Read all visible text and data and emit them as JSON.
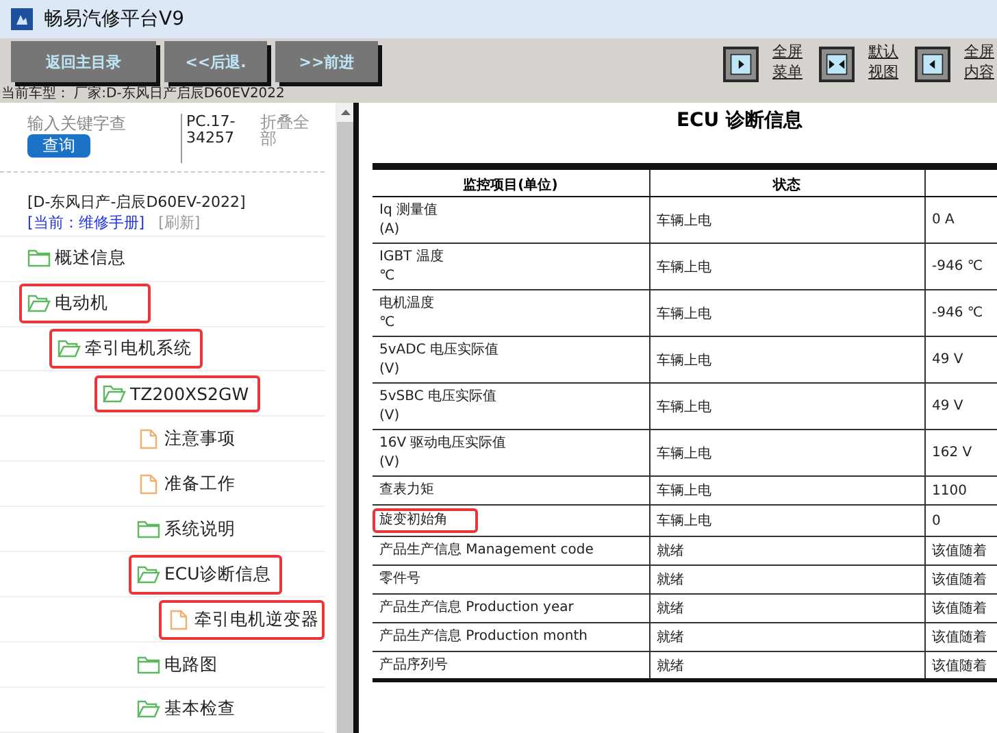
{
  "window": {
    "title": "畅易汽修平台V9"
  },
  "toolbar": {
    "buttons": [
      "返回主目录",
      "<<后退.",
      ">>前进"
    ],
    "view_buttons": [
      {
        "kind": "right",
        "lines": [
          "全屏",
          "菜单"
        ]
      },
      {
        "kind": "both",
        "lines": [
          "默认",
          "视图"
        ]
      },
      {
        "kind": "left",
        "lines": [
          "全屏",
          "内容"
        ]
      }
    ]
  },
  "vehicle_line": "当前车型： 厂家:D-东风日产启辰D60EV2022",
  "sidebar": {
    "search": {
      "placeholder": "输入关键字查",
      "button": "查询"
    },
    "code": "PC.17-34257",
    "collapse_all": "折叠全部",
    "vehicle": "[D-东风日产-启辰D60EV-2022]",
    "current": "[当前：维修手册]",
    "refresh": "[刷新]",
    "tree": [
      {
        "kind": "folder",
        "label": "概述信息",
        "expanded": false,
        "highlighted": false
      },
      {
        "kind": "folder",
        "label": "电动机",
        "expanded": true,
        "highlighted": true,
        "children": [
          {
            "kind": "folder",
            "label": "牵引电机系统",
            "expanded": true,
            "highlighted": true,
            "children": [
              {
                "kind": "folder",
                "label": "TZ200XS2GW",
                "expanded": true,
                "highlighted": true,
                "children": [
                  {
                    "kind": "doc",
                    "label": "注意事项",
                    "highlighted": false
                  },
                  {
                    "kind": "doc",
                    "label": "准备工作",
                    "highlighted": false
                  },
                  {
                    "kind": "folder",
                    "label": "系统说明",
                    "expanded": false,
                    "highlighted": false
                  },
                  {
                    "kind": "folder",
                    "label": "ECU诊断信息",
                    "expanded": true,
                    "highlighted": true,
                    "children": [
                      {
                        "kind": "doc",
                        "label": "牵引电机逆变器",
                        "highlighted": true
                      }
                    ]
                  },
                  {
                    "kind": "folder",
                    "label": "电路图",
                    "expanded": false,
                    "highlighted": false
                  },
                  {
                    "kind": "folder",
                    "label": "基本检查",
                    "expanded": true,
                    "highlighted": false
                  }
                ]
              }
            ]
          }
        ]
      }
    ]
  },
  "document": {
    "title": "ECU 诊断信息",
    "table": {
      "columns": [
        "监控项目(单位)",
        "状态"
      ],
      "rows": [
        {
          "item": "Iq 测量值",
          "unit": "(A)",
          "state": "车辆上电",
          "value": "0 A",
          "highlighted": false
        },
        {
          "item": "IGBT 温度",
          "unit": "℃",
          "state": "车辆上电",
          "value": "-946 ℃",
          "highlighted": false
        },
        {
          "item": "电机温度",
          "unit": "℃",
          "state": "车辆上电",
          "value": "-946 ℃",
          "highlighted": false
        },
        {
          "item": "5vADC 电压实际值",
          "unit": "(V)",
          "state": "车辆上电",
          "value": "49 V",
          "highlighted": false
        },
        {
          "item": "5vSBC 电压实际值",
          "unit": "(V)",
          "state": "车辆上电",
          "value": "49 V",
          "highlighted": false
        },
        {
          "item": "16V 驱动电压实际值",
          "unit": "(V)",
          "state": "车辆上电",
          "value": "162 V",
          "highlighted": false
        },
        {
          "item": "查表力矩",
          "state": "车辆上电",
          "value": "1100",
          "highlighted": false
        },
        {
          "item": "旋变初始角",
          "state": "车辆上电",
          "value": "0",
          "highlighted": true
        },
        {
          "item": "产品生产信息 Management code",
          "state": "就绪",
          "value": "该值随着",
          "highlighted": false
        },
        {
          "item": "零件号",
          "state": "就绪",
          "value": "该值随着",
          "highlighted": false
        },
        {
          "item": "产品生产信息 Production year",
          "state": "就绪",
          "value": "该值随着",
          "highlighted": false
        },
        {
          "item": "产品生产信息 Production month",
          "state": "就绪",
          "value": "该值随着",
          "highlighted": false
        },
        {
          "item": "产品序列号",
          "state": "就绪",
          "value": "该值随着",
          "highlighted": false
        }
      ]
    }
  }
}
